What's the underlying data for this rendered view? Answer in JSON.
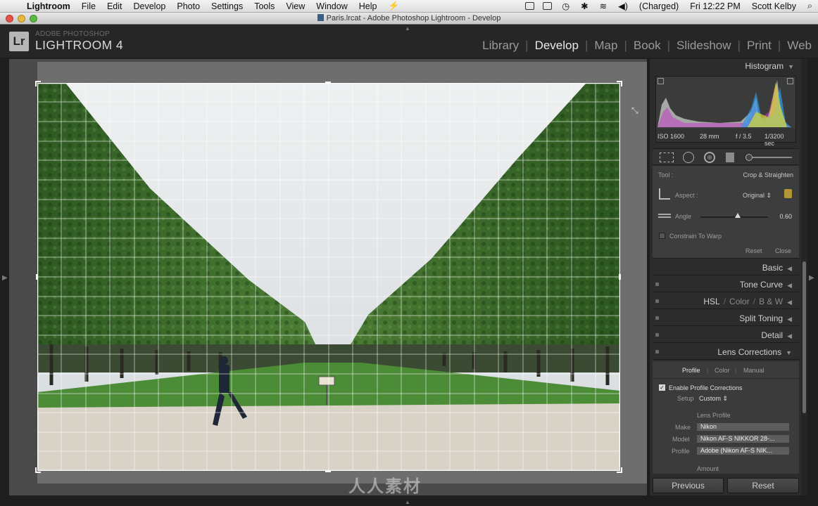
{
  "menubar": {
    "items": [
      "Lightroom",
      "File",
      "Edit",
      "Develop",
      "Photo",
      "Settings",
      "Tools",
      "View",
      "Window",
      "Help"
    ],
    "battery": "(Charged)",
    "clock": "Fri 12:22 PM",
    "user": "Scott Kelby"
  },
  "window": {
    "title": "Paris.lrcat - Adobe Photoshop Lightroom - Develop"
  },
  "identity": {
    "logo": "Lr",
    "brand_top": "ADOBE PHOTOSHOP",
    "brand_main": "LIGHTROOM 4",
    "modules": [
      "Library",
      "Develop",
      "Map",
      "Book",
      "Slideshow",
      "Print",
      "Web"
    ],
    "active_module": "Develop"
  },
  "histogram": {
    "title": "Histogram",
    "iso": "ISO 1600",
    "focal": "28 mm",
    "aperture": "f / 3.5",
    "shutter": "1/3200 sec"
  },
  "crop_tool": {
    "tool_label": "Tool :",
    "tool_value": "Crop & Straighten",
    "aspect_label": "Aspect :",
    "aspect_value": "Original",
    "angle_label": "Angle",
    "angle_value": "0.60",
    "angle_fraction": 0.55,
    "constrain_label": "Constrain To Warp",
    "reset": "Reset",
    "close": "Close"
  },
  "panels": {
    "basic": "Basic",
    "tone_curve": "Tone Curve",
    "hsl": "HSL",
    "color": "Color",
    "bw": "B & W",
    "split_toning": "Split Toning",
    "detail": "Detail",
    "lens_corrections": "Lens Corrections"
  },
  "lens": {
    "tabs": [
      "Profile",
      "Color",
      "Manual"
    ],
    "active_tab": "Profile",
    "enable_label": "Enable Profile Corrections",
    "setup_label": "Setup",
    "setup_value": "Custom",
    "lens_profile_title": "Lens Profile",
    "make_label": "Make",
    "make_value": "Nikon",
    "model_label": "Model",
    "model_value": "Nikon AF-S NIKKOR 28-...",
    "profile_label": "Profile",
    "profile_value": "Adobe (Nikon AF-S NIK...",
    "amount_label": "Amount"
  },
  "footer": {
    "previous": "Previous",
    "reset": "Reset"
  },
  "watermark": "人人素材",
  "colors": {
    "sky": "#dfe3e5",
    "foliage": "#3b6f2a",
    "grass": "#4b8a36",
    "gravel": "#d8d2c6",
    "panel": "#2c2c2c"
  }
}
